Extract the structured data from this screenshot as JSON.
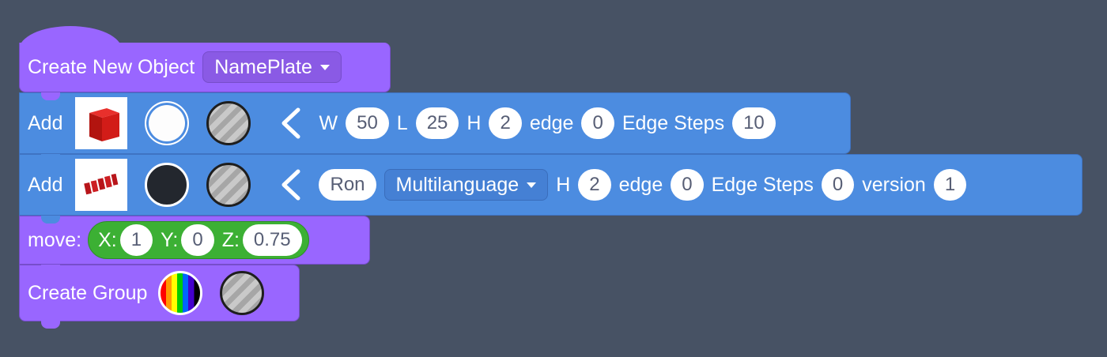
{
  "hat": {
    "label": "Create New Object",
    "dropdown": "NamePlate"
  },
  "add1": {
    "label": "Add",
    "thumb": "red-cube-icon",
    "colors": [
      "white",
      "striped"
    ],
    "w_label": "W",
    "w": "50",
    "l_label": "L",
    "l": "25",
    "h_label": "H",
    "h": "2",
    "edge_label": "edge",
    "edge": "0",
    "steps_label": "Edge Steps",
    "steps": "10"
  },
  "add2": {
    "label": "Add",
    "thumb": "red-3d-text-icon",
    "colors": [
      "dark",
      "striped"
    ],
    "text": "Ron",
    "font": "Multilanguage",
    "h_label": "H",
    "h": "2",
    "edge_label": "edge",
    "edge": "0",
    "steps_label": "Edge Steps",
    "steps": "0",
    "version_label": "version",
    "version": "1"
  },
  "move": {
    "label": "move:",
    "x_label": "X:",
    "x": "1",
    "y_label": "Y:",
    "y": "0",
    "z_label": "Z:",
    "z": "0.75"
  },
  "group": {
    "label": "Create Group"
  },
  "colors": {
    "background": "#475264",
    "purple": "#9966ff",
    "blue": "#4c8ce0",
    "green": "#3cb034"
  }
}
